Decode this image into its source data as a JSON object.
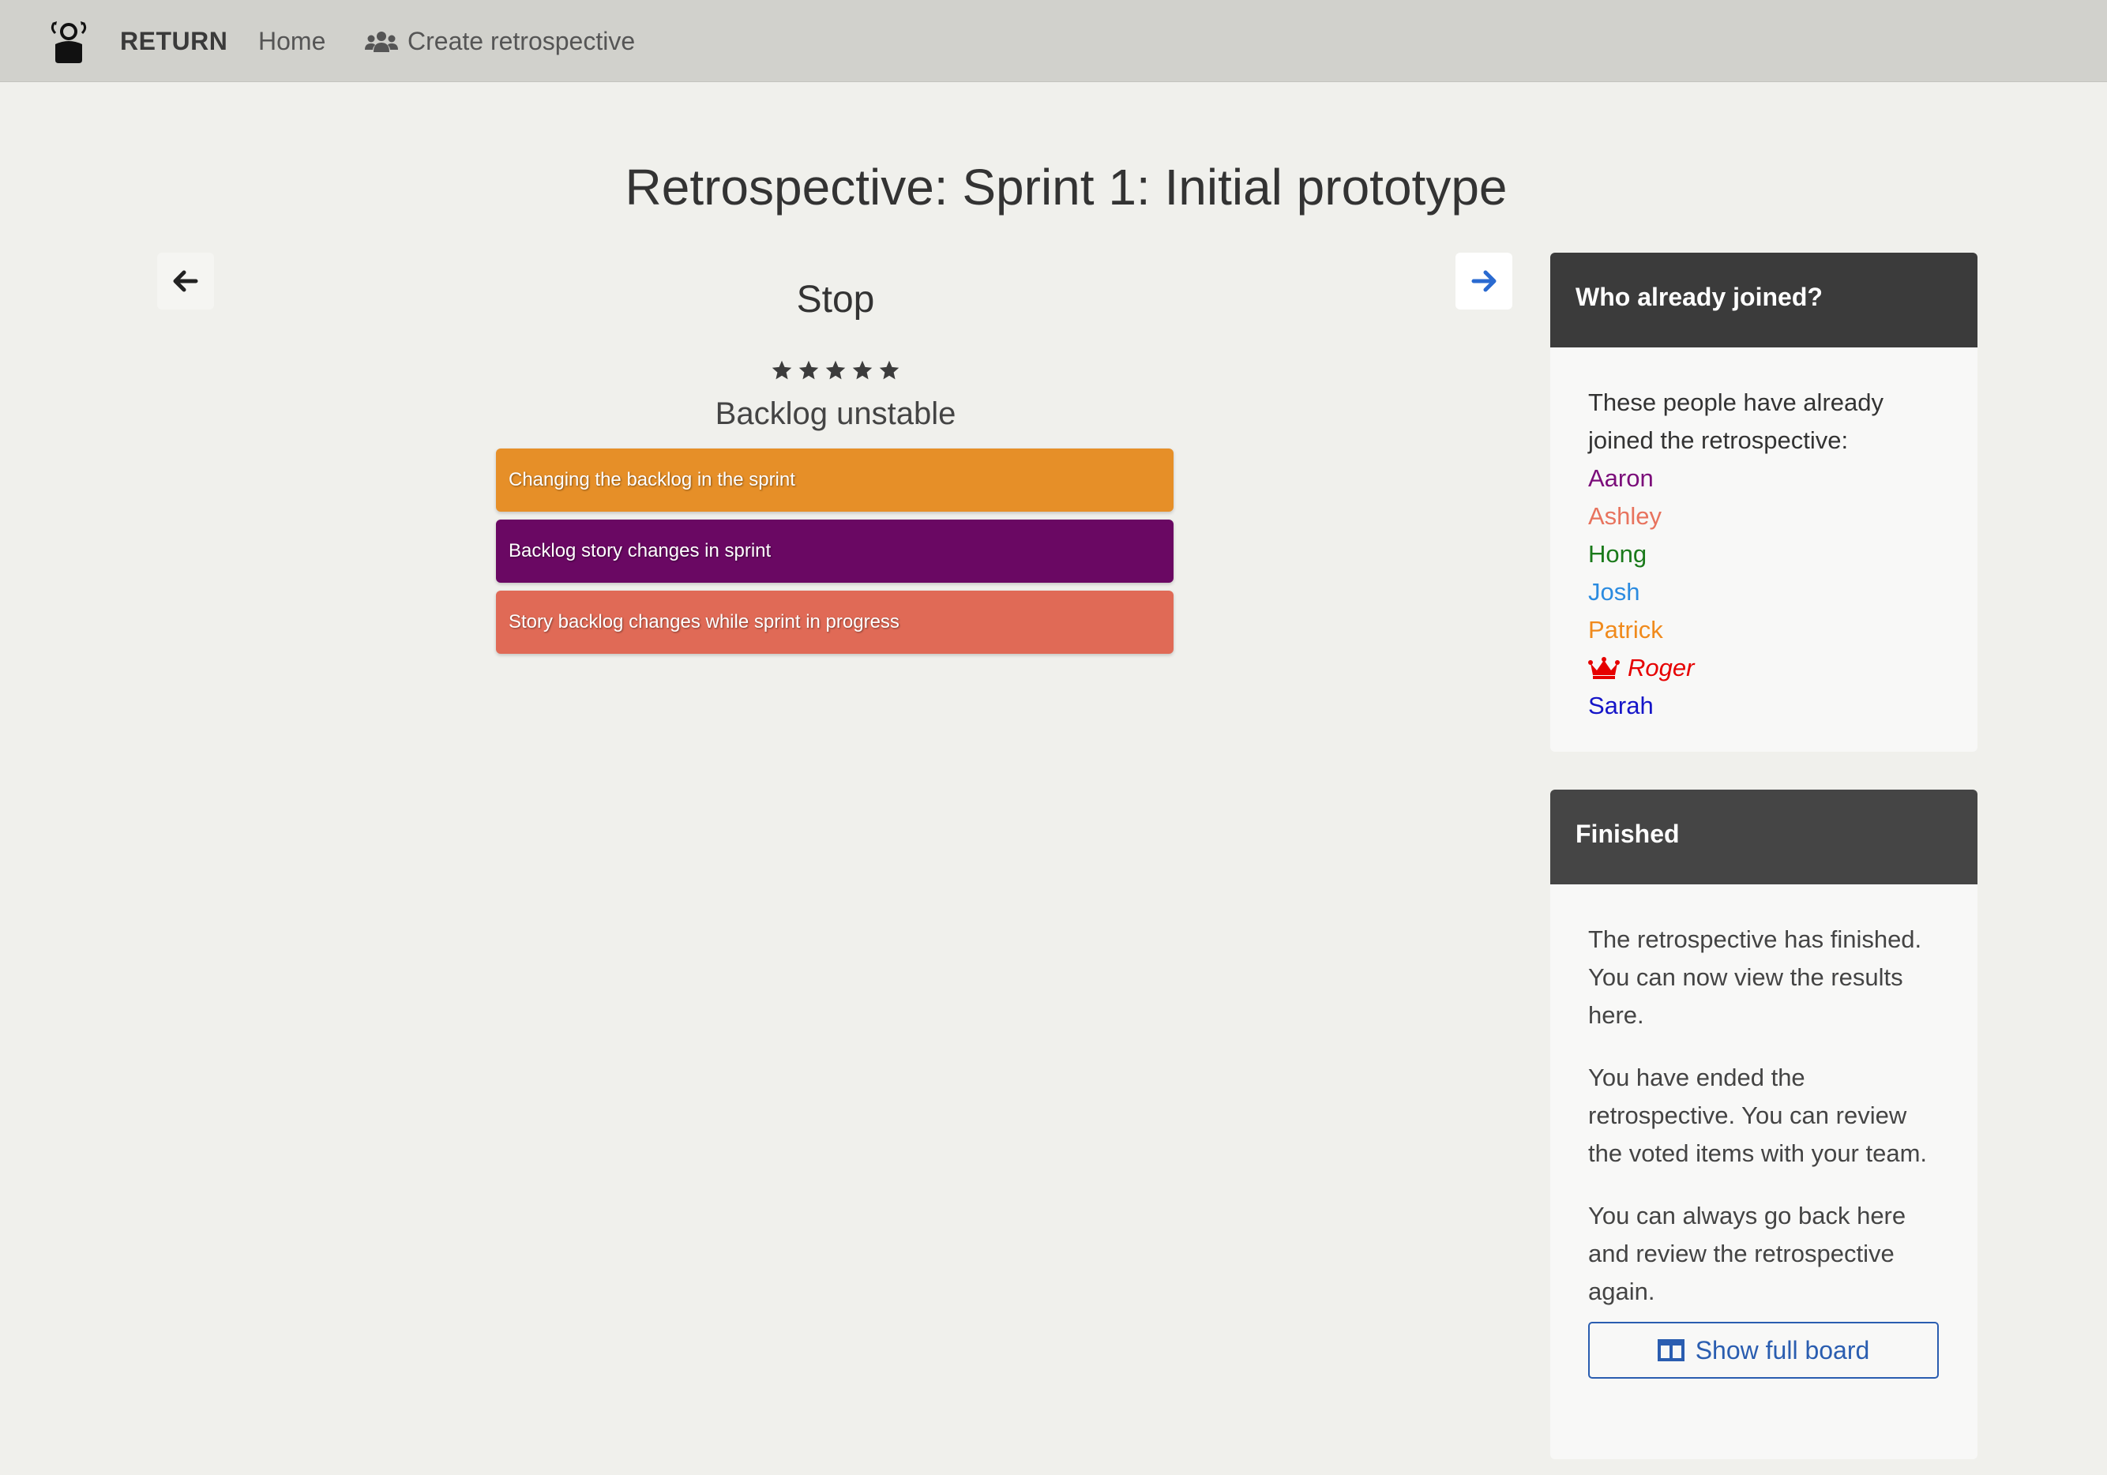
{
  "navbar": {
    "brand": "RETURN",
    "home": "Home",
    "create": "Create retrospective"
  },
  "page": {
    "title": "Retrospective: Sprint 1: Initial prototype"
  },
  "step": {
    "name": "Stop",
    "rating": 5,
    "rating_max": 5,
    "group_title": "Backlog unstable",
    "cards": [
      {
        "text": "Changing the backlog in the sprint",
        "color": "#e68f28"
      },
      {
        "text": "Backlog story changes in sprint",
        "color": "#6a0863"
      },
      {
        "text": "Story backlog changes while sprint in progress",
        "color": "#e06a56"
      }
    ]
  },
  "joined_panel": {
    "title": "Who already joined?",
    "intro": "These people have already joined the retrospective:",
    "members": [
      {
        "name": "Aaron",
        "color": "#7b0d7a"
      },
      {
        "name": "Ashley",
        "color": "#e8735e"
      },
      {
        "name": "Hong",
        "color": "#1a7a1a"
      },
      {
        "name": "Josh",
        "color": "#2b8be0"
      },
      {
        "name": "Patrick",
        "color": "#f08a1c"
      },
      {
        "name": "Roger",
        "color": "#e60000",
        "icon": "crown-icon",
        "is_host": true
      },
      {
        "name": "Sarah",
        "color": "#1515c8"
      }
    ]
  },
  "finished_panel": {
    "title": "Finished",
    "paragraph1": "The retrospective has finished. You can now view the results here.",
    "paragraph2": "You have ended the retrospective. You can review the voted items with your team.",
    "paragraph3": "You can always go back here and review the retrospective again.",
    "button_label": "Show full board"
  },
  "colors": {
    "navbar_bg": "#d1d1cc",
    "page_bg": "#f0f0ec",
    "accent_blue": "#2a5db0"
  }
}
